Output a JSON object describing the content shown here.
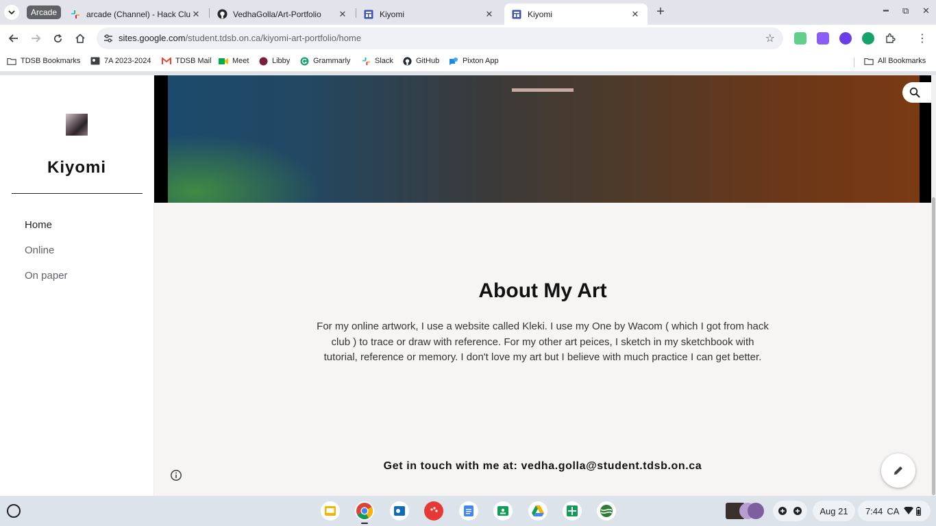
{
  "tabs": {
    "group_label": "Arcade",
    "items": [
      {
        "title": "arcade (Channel) - Hack Club -",
        "icon": "slack-icon"
      },
      {
        "title": "VedhaGolla/Art-Portfolio",
        "icon": "github-icon"
      },
      {
        "title": "Kiyomi",
        "icon": "google-sites-icon"
      },
      {
        "title": "Kiyomi",
        "icon": "google-sites-icon",
        "active": true
      }
    ]
  },
  "omnibox": {
    "host": "sites.google.com",
    "path": "/student.tdsb.on.ca/kiyomi-art-portfolio/home"
  },
  "bookmarks": {
    "items": [
      "TDSB Bookmarks",
      "7A 2023-2024",
      "TDSB Mail",
      "Meet",
      "Libby",
      "Grammarly",
      "Slack",
      "GitHub",
      "Pixton App"
    ],
    "all_label": "All Bookmarks"
  },
  "site": {
    "title": "Kiyomi",
    "nav": [
      "Home",
      "Online",
      "On paper"
    ],
    "current_nav": "Home"
  },
  "content": {
    "heading": "About My Art",
    "body": "For my online artwork, I use a website called Kleki. I use my One by Wacom ( which I got from hack club )  to trace or draw with reference. For my other art peices, I sketch in my sketchbook with tutorial, reference or memory. I don't love my art but I believe with much practice I can get better.",
    "contact": "Get in touch with me at: vedha.golla@student.tdsb.on.ca"
  },
  "shelf": {
    "date": "Aug 21",
    "time": "7:44",
    "region": "CA"
  },
  "colors": {
    "accent": "#1a73e8",
    "page_bg": "#f7f5f4"
  }
}
